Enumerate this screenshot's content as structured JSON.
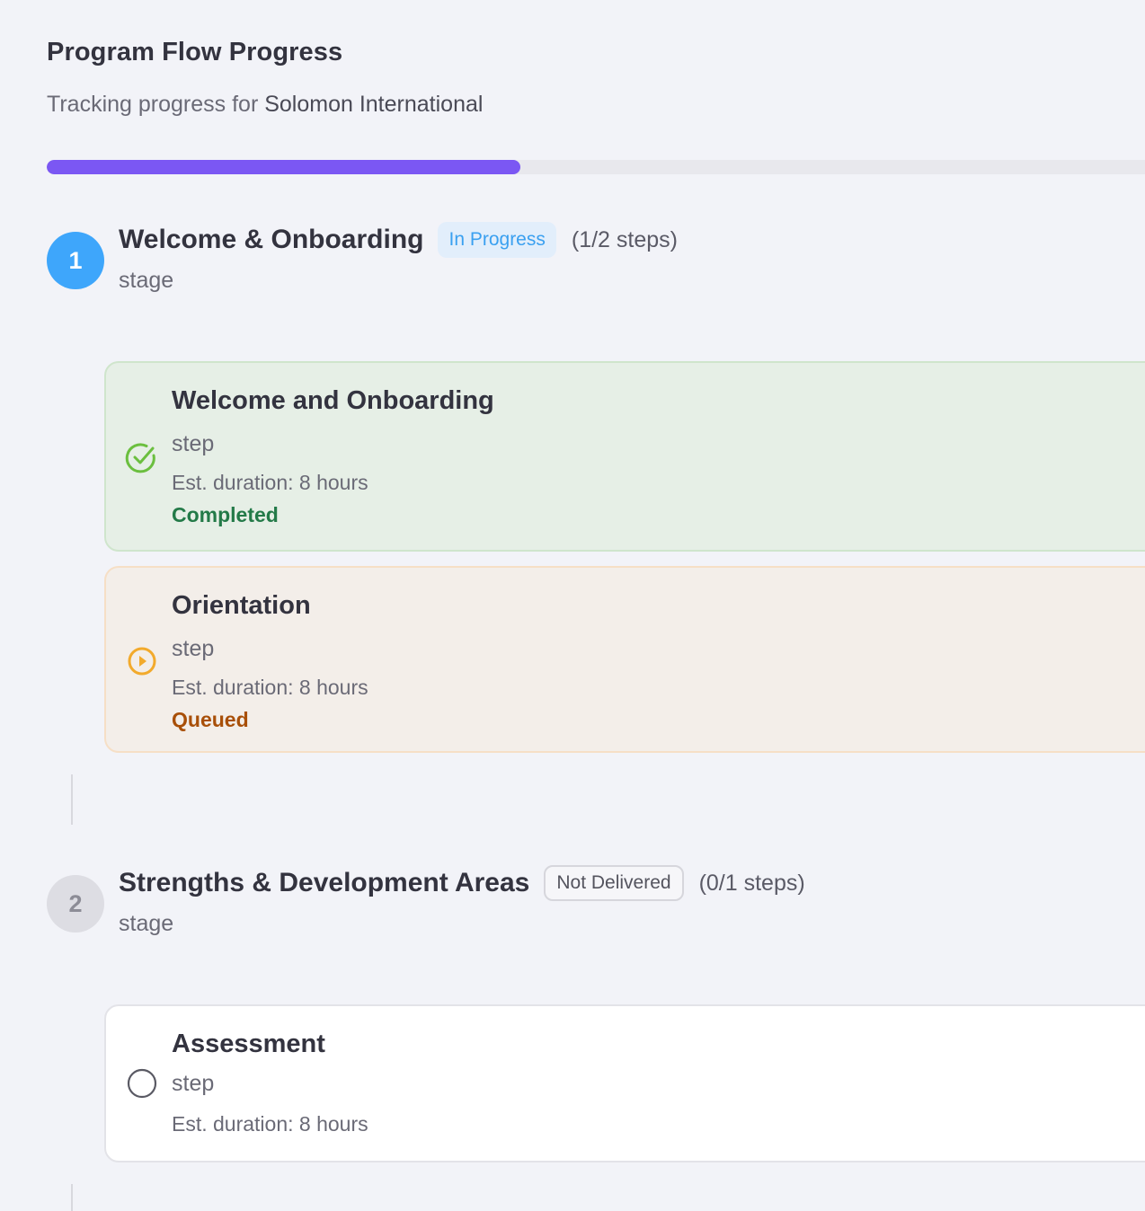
{
  "header": {
    "title": "Program Flow Progress",
    "subtitle_prefix": "Tracking progress for ",
    "organization": "Solomon International"
  },
  "progress": {
    "fraction": 0.425
  },
  "colors": {
    "progress_fill": "#7b57f3",
    "active_stage": "#3ea6fb",
    "completed": "#237a48",
    "queued": "#a84f08"
  },
  "stages": [
    {
      "number": "1",
      "name": "Welcome & Onboarding",
      "status": "In Progress",
      "count": "(1/2 steps)",
      "kind": "stage",
      "steps": [
        {
          "name": "Welcome and Onboarding",
          "kind": "step",
          "duration": "Est. duration: 8 hours",
          "status": "Completed",
          "icon": "check-circle-icon"
        },
        {
          "name": "Orientation",
          "kind": "step",
          "duration": "Est. duration: 8 hours",
          "status": "Queued",
          "icon": "play-circle-icon"
        }
      ]
    },
    {
      "number": "2",
      "name": "Strengths & Development Areas",
      "status": "Not Delivered",
      "count": "(0/1 steps)",
      "kind": "stage",
      "steps": [
        {
          "name": "Assessment",
          "kind": "step",
          "duration": "Est. duration: 8 hours",
          "status": "",
          "icon": "empty-circle-icon"
        }
      ]
    }
  ]
}
